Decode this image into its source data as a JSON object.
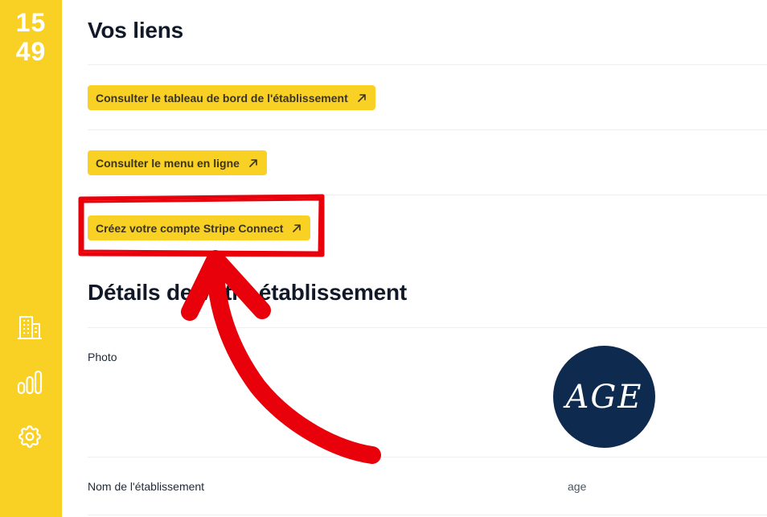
{
  "sidebar": {
    "clock_hours": "15",
    "clock_minutes": "49",
    "icons": [
      "building-icon",
      "bar-chart-icon",
      "gear-icon"
    ]
  },
  "links_section": {
    "title": "Vos liens",
    "buttons": [
      {
        "label": "Consulter le tableau de bord de l'établissement",
        "icon": "external-link-arrow-icon"
      },
      {
        "label": "Consulter le menu en ligne",
        "icon": "external-link-arrow-icon"
      },
      {
        "label": "Créez votre compte Stripe Connect",
        "icon": "external-link-arrow-icon"
      }
    ]
  },
  "details_section": {
    "title": "Détails de votre établissement",
    "photo_label": "Photo",
    "avatar_text": "AGE",
    "name_label": "Nom de l'établissement",
    "name_value": "age"
  },
  "colors": {
    "sidebar": "#f9d024",
    "button": "#f9d024",
    "annotation": "#e8000b",
    "avatar_bg": "#0f2a4f"
  }
}
